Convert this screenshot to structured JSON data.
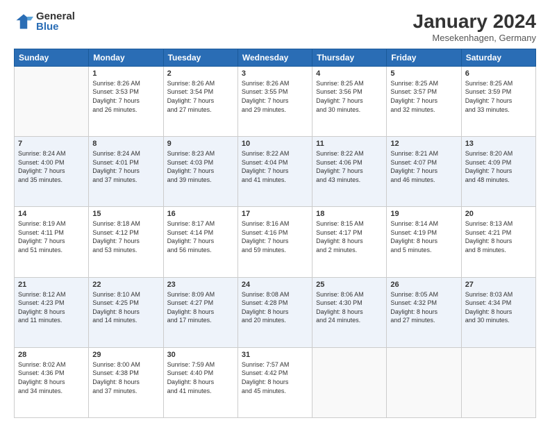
{
  "logo": {
    "general": "General",
    "blue": "Blue"
  },
  "title": {
    "month": "January 2024",
    "location": "Mesekenhagen, Germany"
  },
  "weekdays": [
    "Sunday",
    "Monday",
    "Tuesday",
    "Wednesday",
    "Thursday",
    "Friday",
    "Saturday"
  ],
  "weeks": [
    [
      {
        "day": "",
        "info": ""
      },
      {
        "day": "1",
        "info": "Sunrise: 8:26 AM\nSunset: 3:53 PM\nDaylight: 7 hours\nand 26 minutes."
      },
      {
        "day": "2",
        "info": "Sunrise: 8:26 AM\nSunset: 3:54 PM\nDaylight: 7 hours\nand 27 minutes."
      },
      {
        "day": "3",
        "info": "Sunrise: 8:26 AM\nSunset: 3:55 PM\nDaylight: 7 hours\nand 29 minutes."
      },
      {
        "day": "4",
        "info": "Sunrise: 8:25 AM\nSunset: 3:56 PM\nDaylight: 7 hours\nand 30 minutes."
      },
      {
        "day": "5",
        "info": "Sunrise: 8:25 AM\nSunset: 3:57 PM\nDaylight: 7 hours\nand 32 minutes."
      },
      {
        "day": "6",
        "info": "Sunrise: 8:25 AM\nSunset: 3:59 PM\nDaylight: 7 hours\nand 33 minutes."
      }
    ],
    [
      {
        "day": "7",
        "info": "Sunrise: 8:24 AM\nSunset: 4:00 PM\nDaylight: 7 hours\nand 35 minutes."
      },
      {
        "day": "8",
        "info": "Sunrise: 8:24 AM\nSunset: 4:01 PM\nDaylight: 7 hours\nand 37 minutes."
      },
      {
        "day": "9",
        "info": "Sunrise: 8:23 AM\nSunset: 4:03 PM\nDaylight: 7 hours\nand 39 minutes."
      },
      {
        "day": "10",
        "info": "Sunrise: 8:22 AM\nSunset: 4:04 PM\nDaylight: 7 hours\nand 41 minutes."
      },
      {
        "day": "11",
        "info": "Sunrise: 8:22 AM\nSunset: 4:06 PM\nDaylight: 7 hours\nand 43 minutes."
      },
      {
        "day": "12",
        "info": "Sunrise: 8:21 AM\nSunset: 4:07 PM\nDaylight: 7 hours\nand 46 minutes."
      },
      {
        "day": "13",
        "info": "Sunrise: 8:20 AM\nSunset: 4:09 PM\nDaylight: 7 hours\nand 48 minutes."
      }
    ],
    [
      {
        "day": "14",
        "info": "Sunrise: 8:19 AM\nSunset: 4:11 PM\nDaylight: 7 hours\nand 51 minutes."
      },
      {
        "day": "15",
        "info": "Sunrise: 8:18 AM\nSunset: 4:12 PM\nDaylight: 7 hours\nand 53 minutes."
      },
      {
        "day": "16",
        "info": "Sunrise: 8:17 AM\nSunset: 4:14 PM\nDaylight: 7 hours\nand 56 minutes."
      },
      {
        "day": "17",
        "info": "Sunrise: 8:16 AM\nSunset: 4:16 PM\nDaylight: 7 hours\nand 59 minutes."
      },
      {
        "day": "18",
        "info": "Sunrise: 8:15 AM\nSunset: 4:17 PM\nDaylight: 8 hours\nand 2 minutes."
      },
      {
        "day": "19",
        "info": "Sunrise: 8:14 AM\nSunset: 4:19 PM\nDaylight: 8 hours\nand 5 minutes."
      },
      {
        "day": "20",
        "info": "Sunrise: 8:13 AM\nSunset: 4:21 PM\nDaylight: 8 hours\nand 8 minutes."
      }
    ],
    [
      {
        "day": "21",
        "info": "Sunrise: 8:12 AM\nSunset: 4:23 PM\nDaylight: 8 hours\nand 11 minutes."
      },
      {
        "day": "22",
        "info": "Sunrise: 8:10 AM\nSunset: 4:25 PM\nDaylight: 8 hours\nand 14 minutes."
      },
      {
        "day": "23",
        "info": "Sunrise: 8:09 AM\nSunset: 4:27 PM\nDaylight: 8 hours\nand 17 minutes."
      },
      {
        "day": "24",
        "info": "Sunrise: 8:08 AM\nSunset: 4:28 PM\nDaylight: 8 hours\nand 20 minutes."
      },
      {
        "day": "25",
        "info": "Sunrise: 8:06 AM\nSunset: 4:30 PM\nDaylight: 8 hours\nand 24 minutes."
      },
      {
        "day": "26",
        "info": "Sunrise: 8:05 AM\nSunset: 4:32 PM\nDaylight: 8 hours\nand 27 minutes."
      },
      {
        "day": "27",
        "info": "Sunrise: 8:03 AM\nSunset: 4:34 PM\nDaylight: 8 hours\nand 30 minutes."
      }
    ],
    [
      {
        "day": "28",
        "info": "Sunrise: 8:02 AM\nSunset: 4:36 PM\nDaylight: 8 hours\nand 34 minutes."
      },
      {
        "day": "29",
        "info": "Sunrise: 8:00 AM\nSunset: 4:38 PM\nDaylight: 8 hours\nand 37 minutes."
      },
      {
        "day": "30",
        "info": "Sunrise: 7:59 AM\nSunset: 4:40 PM\nDaylight: 8 hours\nand 41 minutes."
      },
      {
        "day": "31",
        "info": "Sunrise: 7:57 AM\nSunset: 4:42 PM\nDaylight: 8 hours\nand 45 minutes."
      },
      {
        "day": "",
        "info": ""
      },
      {
        "day": "",
        "info": ""
      },
      {
        "day": "",
        "info": ""
      }
    ]
  ]
}
